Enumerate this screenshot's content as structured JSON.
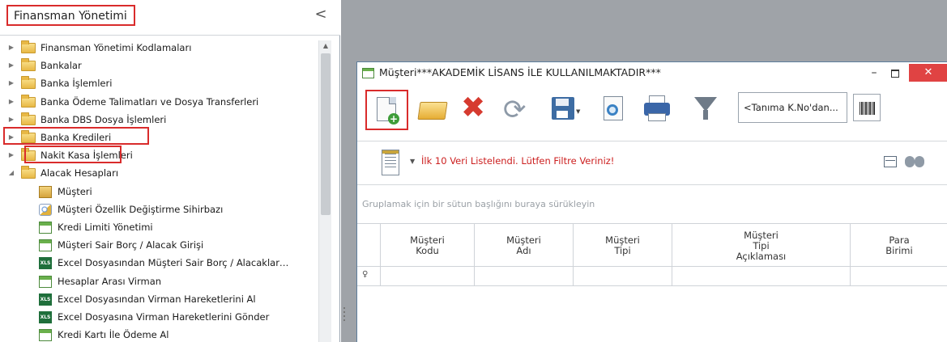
{
  "left_panel": {
    "title": "Finansman Yönetimi",
    "collapse_glyph": "<",
    "tree": [
      {
        "label": "Finansman Yönetimi Kodlamaları",
        "icon": "folder-icon",
        "expander": "▶"
      },
      {
        "label": "Bankalar",
        "icon": "folder-icon",
        "expander": "▶"
      },
      {
        "label": "Banka İşlemleri",
        "icon": "folder-icon",
        "expander": "▶"
      },
      {
        "label": "Banka Ödeme Talimatları ve Dosya Transferleri",
        "icon": "folder-icon",
        "expander": "▶"
      },
      {
        "label": "Banka DBS Dosya İşlemleri",
        "icon": "folder-icon",
        "expander": "▶"
      },
      {
        "label": "Banka Kredileri",
        "icon": "folder-icon",
        "expander": "▶"
      },
      {
        "label": "Nakit Kasa İşlemleri",
        "icon": "folder-icon",
        "expander": "▶"
      },
      {
        "label": "Alacak Hesapları",
        "icon": "folder-icon",
        "expander": "◢"
      },
      {
        "label": "Müşteri",
        "icon": "customer-icon"
      },
      {
        "label": "Müşteri Özellik Değiştirme Sihirbazı",
        "icon": "wizard-icon"
      },
      {
        "label": "Kredi Limiti Yönetimi",
        "icon": "grid-icon"
      },
      {
        "label": "Müşteri Sair Borç / Alacak Girişi",
        "icon": "grid-icon"
      },
      {
        "label": "Excel Dosyasından Müşteri Sair Borç / Alacaklar…",
        "icon": "excel-icon"
      },
      {
        "label": "Hesaplar Arası Virman",
        "icon": "grid-icon"
      },
      {
        "label": "Excel Dosyasından Virman Hareketlerini Al",
        "icon": "excel-icon"
      },
      {
        "label": "Excel Dosyasına Virman Hareketlerini Gönder",
        "icon": "excel-icon"
      },
      {
        "label": "Kredi Kartı İle Ödeme Al",
        "icon": "grid-icon"
      }
    ],
    "excel_badge": "XLS"
  },
  "window": {
    "title": "Müşteri***AKADEMİK LİSANS İLE KULLANILMAKTADIR***",
    "minimize_glyph": "–",
    "close_glyph": "✕"
  },
  "toolbar": {
    "new_plus": "+",
    "delete_glyph": "✖",
    "refresh_glyph": "⟳",
    "dropdown_glyph": "▼",
    "search_placeholder": "<Tanıma K.No'dan..."
  },
  "info_bar": {
    "arrow": "▼",
    "message": "İlk 10 Veri Listelendi. Lütfen Filtre Veriniz!"
  },
  "group_panel": {
    "hint": "Gruplamak için bir sütun başlığını buraya sürükleyin"
  },
  "grid": {
    "columns": [
      "Müşteri\nKodu",
      "Müşteri\nAdı",
      "Müşteri\nTipi",
      "Müşteri\nTipi\nAçıklaması",
      "Para\nBirimi"
    ],
    "filter_glyph": "♀"
  },
  "colors": {
    "highlight_red": "#d92b2b",
    "message_red": "#cc1f1f",
    "workspace_gray": "#9fa3a8",
    "close_button_red": "#e04343"
  }
}
